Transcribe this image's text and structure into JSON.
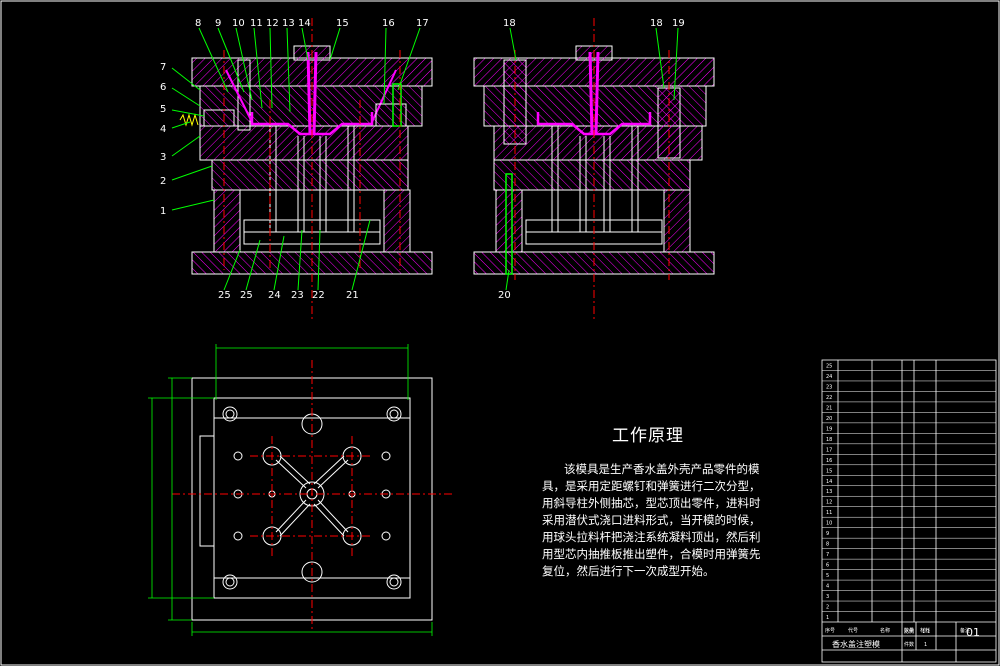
{
  "drawing": {
    "title": "工作原理",
    "description": "该模具是生产香水盖外壳产品零件的模具，是采用定距螺钉和弹簧进行二次分型，用斜导柱外侧抽芯，型芯顶出零件，进料时采用潜伏式浇口进料形式，当开模的时候，用球头拉料杆把浇注系统凝料顶出，然后利用型芯内抽推板推出塑件，合模时用弹簧先复位，然后进行下一次成型开始。"
  },
  "part_numbers": {
    "left_top": [
      "8",
      "9",
      "10",
      "11",
      "12",
      "13",
      "14",
      "15",
      "16",
      "17"
    ],
    "left_side": [
      "7",
      "6",
      "5",
      "4",
      "3",
      "2",
      "1"
    ],
    "left_bottom": [
      "25",
      "25",
      "24",
      "23",
      "22",
      "21"
    ],
    "right_top": [
      "18",
      "18",
      "19"
    ],
    "right_bottom": [
      "20"
    ]
  },
  "title_block": {
    "product_name": "香水盖注塑模",
    "drawing_number": "01",
    "scale_label": "比例",
    "scale_value": "1:1",
    "sheet_label": "件数",
    "sheet_value": "1",
    "header_labels": [
      "序号",
      "代号",
      "名称",
      "数量",
      "材料",
      "备注"
    ],
    "row_numbers": [
      "25",
      "24",
      "23",
      "22",
      "21",
      "20",
      "19",
      "18",
      "17",
      "16",
      "15",
      "14",
      "13",
      "12",
      "11",
      "10",
      "9",
      "8",
      "7",
      "6",
      "5",
      "4",
      "3",
      "2",
      "1"
    ]
  },
  "colors": {
    "outline": "#ffffff",
    "hatch": "#ff00ff",
    "centerline": "#ff0000",
    "part": "#00ff00",
    "leader": "#00ff00",
    "accent": "#ffff00"
  }
}
